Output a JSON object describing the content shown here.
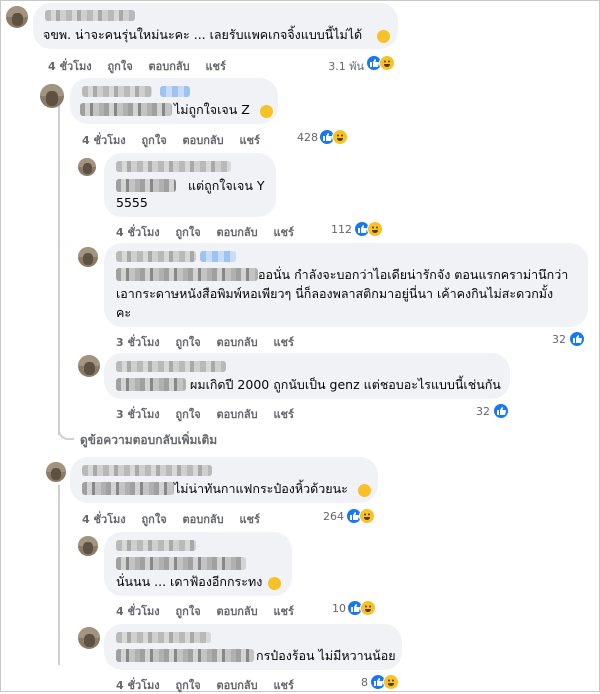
{
  "comments": [
    {
      "text": "จขพ. น่าจะคนรุ่นใหม่นะคะ ... เลยรับแพคเกจจิ้งแบบนี้ไม่ได้",
      "time": "4 ชั่วโมง",
      "count": "3.1 พัน",
      "reactions": [
        "like-icon",
        "haha-icon"
      ],
      "emoji": "grin-emoji"
    },
    {
      "text": "ไม่ถูกใจเจน Z",
      "time": "4 ชั่วโมง",
      "count": "428",
      "reactions": [
        "like-icon",
        "haha-icon"
      ],
      "emoji": "grin-emoji"
    },
    {
      "text": "แต่ถูกใจเจน Y",
      "text2": "5555",
      "time": "4 ชั่วโมง",
      "count": "112",
      "reactions": [
        "like-icon",
        "haha-icon"
      ]
    },
    {
      "text": "ออนั่น กำลังจะบอกว่าไอเดียน่ารักจัง ตอนแรกคราม่านึกว่า",
      "text2": "เอากระดาษหนังสือพิมพ์หอเพียวๆ นี่ก็ลองพลาสติกมาอยู่นี่นา เค้าคงกินไม่สะดวกมั้ง",
      "text3": "คะ",
      "time": "3 ชั่วโมง",
      "count": "32",
      "reactions": [
        "like-icon"
      ]
    },
    {
      "text": "ผมเกิดปี 2000 ถูกนับเป็น genz แต่ชอบอะไรแบบนี้เช่นกัน",
      "time": "3 ชั่วโมง",
      "count": "32",
      "reactions": [
        "like-icon"
      ]
    },
    {
      "text": "ไม่น่าทันกาแฟกระป๋องหิ้วด้วยนะ",
      "time": "4 ชั่วโมง",
      "count": "264",
      "reactions": [
        "like-icon",
        "haha-icon"
      ],
      "emoji": "rofl-emoji"
    },
    {
      "text": "นั่นนน ... เดาฟ้องอีกกระทง",
      "time": "4 ชั่วโมง",
      "count": "10",
      "reactions": [
        "like-icon",
        "haha-icon"
      ],
      "emoji": "grimace-emoji"
    },
    {
      "text": "กรป๋องร้อน ไม่มีหวานน้อย",
      "time": "4 ชั่วโมง",
      "count": "8",
      "reactions": [
        "like-icon",
        "haha-icon"
      ]
    }
  ],
  "actions": {
    "like": "ถูกใจ",
    "reply": "ตอบกลับ",
    "share": "แชร์"
  },
  "more_replies": "ดูข้อความตอบกลับเพิ่มเติม",
  "colors": {
    "bubble": "#f0f2f5",
    "meta": "#65676b",
    "like": "#1877f2",
    "haha": "#f7c128"
  }
}
